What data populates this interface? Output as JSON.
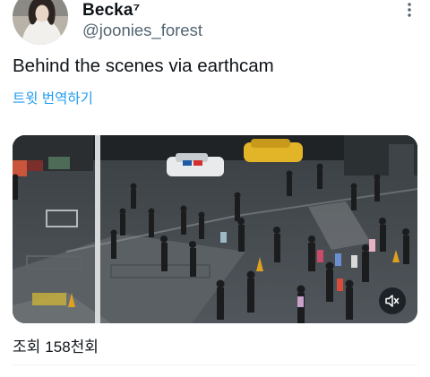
{
  "author": {
    "display_name": "Becka⁷",
    "handle": "@joonies_forest"
  },
  "tweet": {
    "text": "Behind the scenes via earthcam",
    "translate_label": "트윗 번역하기"
  },
  "media": {
    "type": "video",
    "muted_icon": "speaker-muted-icon"
  },
  "stats": {
    "views_label": "조회",
    "views_count": "158천회"
  },
  "colors": {
    "link": "#1d9bf0",
    "secondary_text": "#536471"
  }
}
